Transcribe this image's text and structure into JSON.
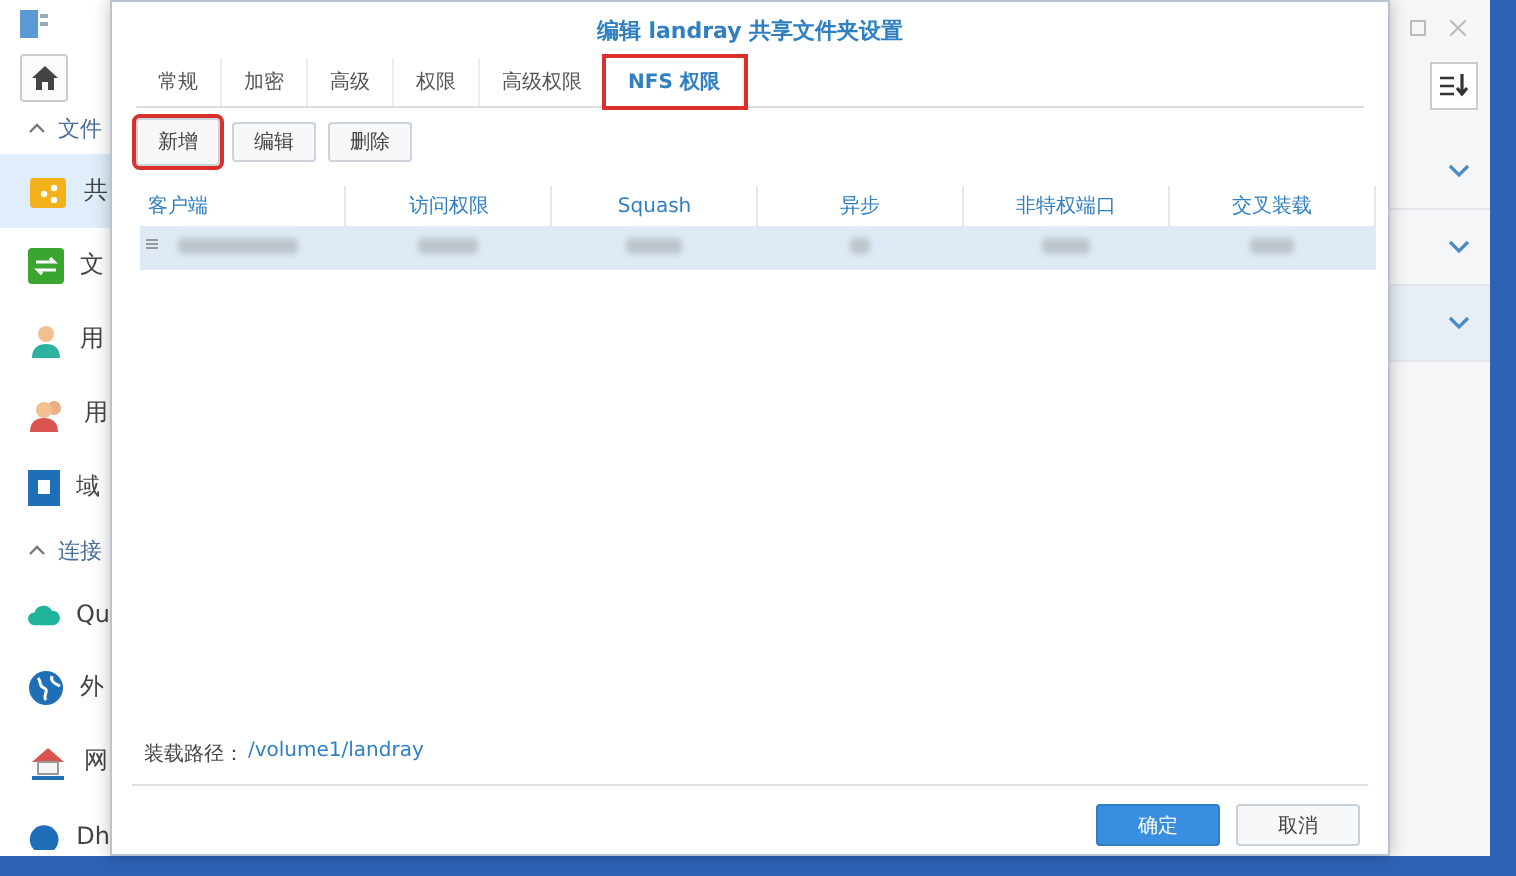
{
  "background_window": {
    "sidebar": [
      {
        "kind": "header",
        "label": "文件",
        "expanded": true
      },
      {
        "kind": "item",
        "label": "共",
        "selected": true
      },
      {
        "kind": "item",
        "label": "文",
        "selected": false
      },
      {
        "kind": "item",
        "label": "用",
        "selected": false
      },
      {
        "kind": "item",
        "label": "用",
        "selected": false
      },
      {
        "kind": "item",
        "label": "域",
        "selected": false
      },
      {
        "kind": "header",
        "label": "连接",
        "expanded": true
      },
      {
        "kind": "item",
        "label": "Qu",
        "selected": false
      },
      {
        "kind": "item",
        "label": "外",
        "selected": false
      },
      {
        "kind": "item",
        "label": "网",
        "selected": false
      },
      {
        "kind": "item",
        "label": "Dh",
        "selected": false
      }
    ]
  },
  "dialog": {
    "title": "编辑 landray 共享文件夹设置",
    "tabs": [
      {
        "label": "常规",
        "selected": false,
        "highlighted": false
      },
      {
        "label": "加密",
        "selected": false,
        "highlighted": false
      },
      {
        "label": "高级",
        "selected": false,
        "highlighted": false
      },
      {
        "label": "权限",
        "selected": false,
        "highlighted": false
      },
      {
        "label": "高级权限",
        "selected": false,
        "highlighted": false
      },
      {
        "label": "NFS 权限",
        "selected": true,
        "highlighted": true
      }
    ],
    "toolbar": [
      {
        "label": "新增",
        "highlighted": true
      },
      {
        "label": "编辑",
        "highlighted": false
      },
      {
        "label": "删除",
        "highlighted": false
      }
    ],
    "table": {
      "columns": [
        "客户端",
        "访问权限",
        "Squash",
        "异步",
        "非特权端口",
        "交叉装载"
      ],
      "rows": [
        {
          "selected": true,
          "redacted": true
        }
      ]
    },
    "mount_path_label": "装载路径：",
    "mount_path": "/volume1/landray",
    "buttons": [
      {
        "label": "确定",
        "kind": "primary"
      },
      {
        "label": "取消",
        "kind": "secondary"
      }
    ]
  }
}
